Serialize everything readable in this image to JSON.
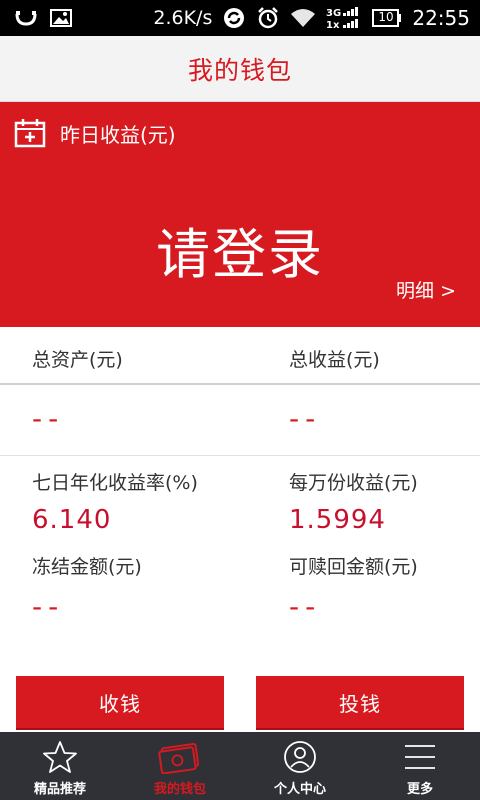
{
  "status_bar": {
    "speed": "2.6K/s",
    "network": "3G",
    "network2": "1x",
    "battery": "10",
    "time": "22:55"
  },
  "header": {
    "title": "我的钱包"
  },
  "banner": {
    "label": "昨日收益(元)",
    "login": "请登录",
    "detail": "明细 >"
  },
  "assets": {
    "total_assets_label": "总资产(元)",
    "total_assets_value": "--",
    "total_income_label": "总收益(元)",
    "total_income_value": "--"
  },
  "stats": {
    "seven_day_label": "七日年化收益率(%)",
    "seven_day_value": "6.140",
    "per_10k_label": "每万份收益(元)",
    "per_10k_value": "1.5994",
    "frozen_label": "冻结金额(元)",
    "frozen_value": "--",
    "redeemable_label": "可赎回金额(元)",
    "redeemable_value": "--"
  },
  "buttons": {
    "collect": "收钱",
    "invest": "投钱"
  },
  "tabs": [
    {
      "label": "精品推荐",
      "icon": "star-icon"
    },
    {
      "label": "我的钱包",
      "icon": "wallet-icon"
    },
    {
      "label": "个人中心",
      "icon": "person-icon"
    },
    {
      "label": "更多",
      "icon": "menu-icon"
    }
  ],
  "colors": {
    "accent": "#d71920",
    "tabbar": "#2f3137"
  }
}
